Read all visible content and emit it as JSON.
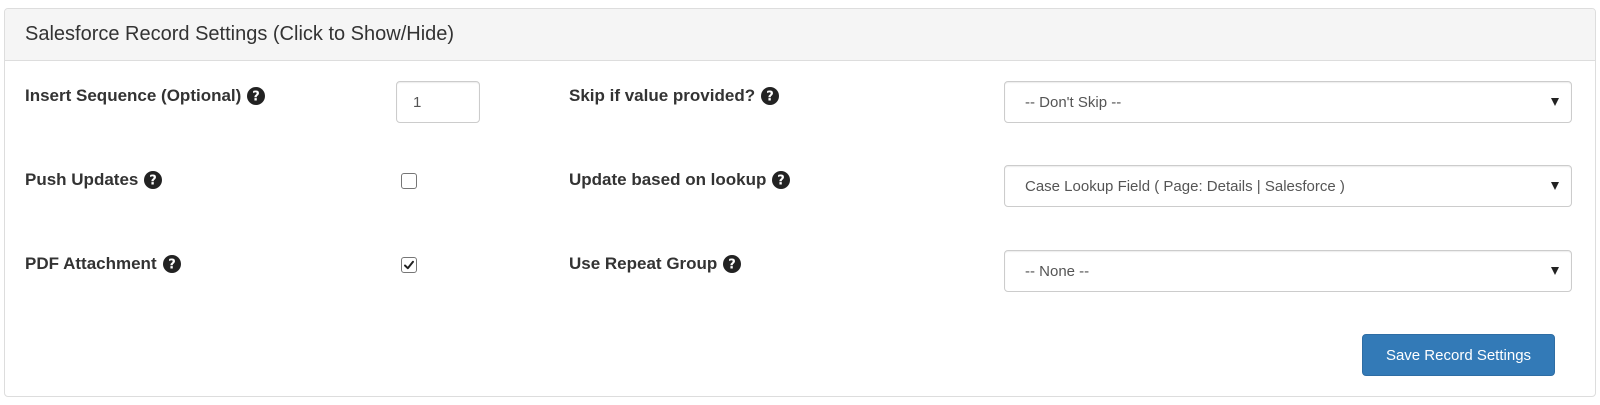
{
  "panel": {
    "title": "Salesforce Record Settings (Click to Show/Hide)"
  },
  "left_fields": {
    "insert_sequence": {
      "label": "Insert Sequence (Optional)",
      "value": "1"
    },
    "push_updates": {
      "label": "Push Updates",
      "checked": false
    },
    "pdf_attachment": {
      "label": "PDF Attachment",
      "checked": true
    }
  },
  "right_fields": {
    "skip_if_value": {
      "label": "Skip if value provided?",
      "selected": "-- Don't Skip --"
    },
    "update_lookup": {
      "label": "Update based on lookup",
      "selected": "Case Lookup Field ( Page: Details | Salesforce )"
    },
    "repeat_group": {
      "label": "Use Repeat Group",
      "selected": "-- None --"
    }
  },
  "actions": {
    "save_label": "Save Record Settings"
  },
  "icons": {
    "help": "question-circle-icon",
    "checkmark": "checkmark-icon",
    "dropdown": "caret-down-icon"
  },
  "colors": {
    "primary_button": "#337ab7",
    "heading_bg": "#f5f5f5",
    "text": "#333333"
  }
}
